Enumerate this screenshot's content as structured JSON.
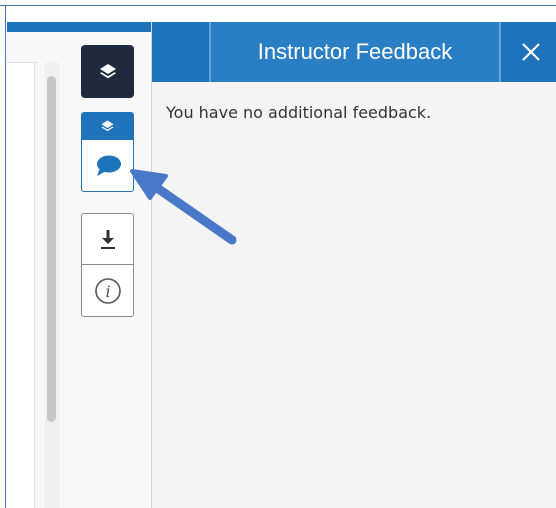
{
  "panel": {
    "title": "Instructor Feedback",
    "message": "You have no additional feedback."
  },
  "toolbar": {
    "layers_icon": "layers-icon",
    "feedback_icon": "speech-bubble-icon",
    "download_icon": "download-icon",
    "info_icon": "info-icon",
    "close_icon": "close-icon"
  },
  "colors": {
    "accent": "#1f73ba",
    "dark_button": "#1e2a3e",
    "annotation_arrow": "#4a78c8"
  }
}
